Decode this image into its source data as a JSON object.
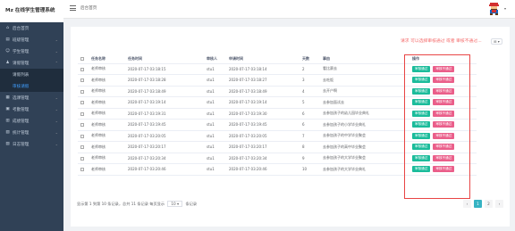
{
  "app": {
    "title": "Mz 在线学生管理系统"
  },
  "sidebar": {
    "items": [
      {
        "label": "后台首页",
        "icon": "home-icon",
        "glyph": "⌂",
        "has_arrow": false
      },
      {
        "label": "班级管理",
        "icon": "book-icon",
        "glyph": "▤",
        "has_arrow": true
      },
      {
        "label": "学生管理",
        "icon": "user-icon",
        "glyph": "☺",
        "has_arrow": true
      },
      {
        "label": "请假管理",
        "icon": "group-icon",
        "glyph": "♟",
        "has_arrow": true,
        "expanded": true
      },
      {
        "label": "请假列表",
        "sub": true
      },
      {
        "label": "审核请假",
        "sub": true,
        "active": true
      },
      {
        "label": "选课管理",
        "icon": "grid-icon",
        "glyph": "▦",
        "has_arrow": true
      },
      {
        "label": "考勤管理",
        "icon": "clipboard-icon",
        "glyph": "▣",
        "has_arrow": true
      },
      {
        "label": "成绩管理",
        "icon": "chart-icon",
        "glyph": "▥",
        "has_arrow": true
      },
      {
        "label": "统计管理",
        "icon": "stats-icon",
        "glyph": "▧",
        "has_arrow": true
      },
      {
        "label": "日志管理",
        "icon": "log-icon",
        "glyph": "▨",
        "has_arrow": true
      }
    ]
  },
  "topbar": {
    "breadcrumb": "后台首页",
    "user_caret": "▾"
  },
  "main": {
    "hint": "请求 可以选择审核通过 或者 审核不通过...",
    "tools_label": "⊞ ▾",
    "columns": [
      "任务名称",
      "任务时间",
      "审核人",
      "申请时间",
      "天数",
      "事由",
      "操作"
    ],
    "rows": [
      {
        "name": "老师审核",
        "time": "2020-07-17 03:18:15",
        "reviewer": "stu1",
        "apply": "2020-07-17 03:18:14",
        "days": "2",
        "reason": "看比赛去"
      },
      {
        "name": "老师审核",
        "time": "2020-07-17 03:18:28",
        "reviewer": "stu1",
        "apply": "2020-07-17 03:18:27",
        "days": "3",
        "reason": "去吃饭"
      },
      {
        "name": "老师审核",
        "time": "2020-07-17 03:18:49",
        "reviewer": "stu1",
        "apply": "2020-07-17 03:18:49",
        "days": "4",
        "reason": "去开户啊"
      },
      {
        "name": "老师审核",
        "time": "2020-07-17 03:19:14",
        "reviewer": "stu1",
        "apply": "2020-07-17 03:19:14",
        "days": "5",
        "reason": "去参加面试去"
      },
      {
        "name": "老师审核",
        "time": "2020-07-17 03:19:31",
        "reviewer": "stu1",
        "apply": "2020-07-17 03:19:30",
        "days": "6",
        "reason": "去参加孩子的幼儿园毕业典礼"
      },
      {
        "name": "老师审核",
        "time": "2020-07-17 03:19:45",
        "reviewer": "stu1",
        "apply": "2020-07-17 03:19:45",
        "days": "6",
        "reason": "去参加孩子的小学毕业典礼"
      },
      {
        "name": "老师审核",
        "time": "2020-07-17 03:20:05",
        "reviewer": "stu1",
        "apply": "2020-07-17 03:20:05",
        "days": "7",
        "reason": "去参加孩子的中学毕业聚会"
      },
      {
        "name": "老师审核",
        "time": "2020-07-17 03:20:17",
        "reviewer": "stu1",
        "apply": "2020-07-17 03:20:17",
        "days": "8",
        "reason": "去参加孩子的高中毕业聚会"
      },
      {
        "name": "老师审核",
        "time": "2020-07-17 03:20:34",
        "reviewer": "stu1",
        "apply": "2020-07-17 03:20:34",
        "days": "9",
        "reason": "去参加孩子的大学毕业聚会"
      },
      {
        "name": "老师审核",
        "time": "2020-07-17 03:20:46",
        "reviewer": "stu1",
        "apply": "2020-07-17 03:20:46",
        "days": "10",
        "reason": "去参加孩子的大学毕业典礼"
      }
    ],
    "btn_pass": "审核通过",
    "btn_fail": "审核不通过"
  },
  "footer": {
    "summary": "显示第 1 到第 10 条记录，总共 11 条记录 每页显示",
    "page_size": "10 ▾",
    "suffix": "条记录"
  },
  "pager": {
    "prev": "‹",
    "pages": [
      "1",
      "2"
    ],
    "current": "1",
    "next": "›"
  },
  "colors": {
    "sidebar_bg": "#304156",
    "pass": "#1bbc9b",
    "fail": "#ea5e8a",
    "hint": "#f56c6c",
    "pager_active": "#36b3c3"
  }
}
